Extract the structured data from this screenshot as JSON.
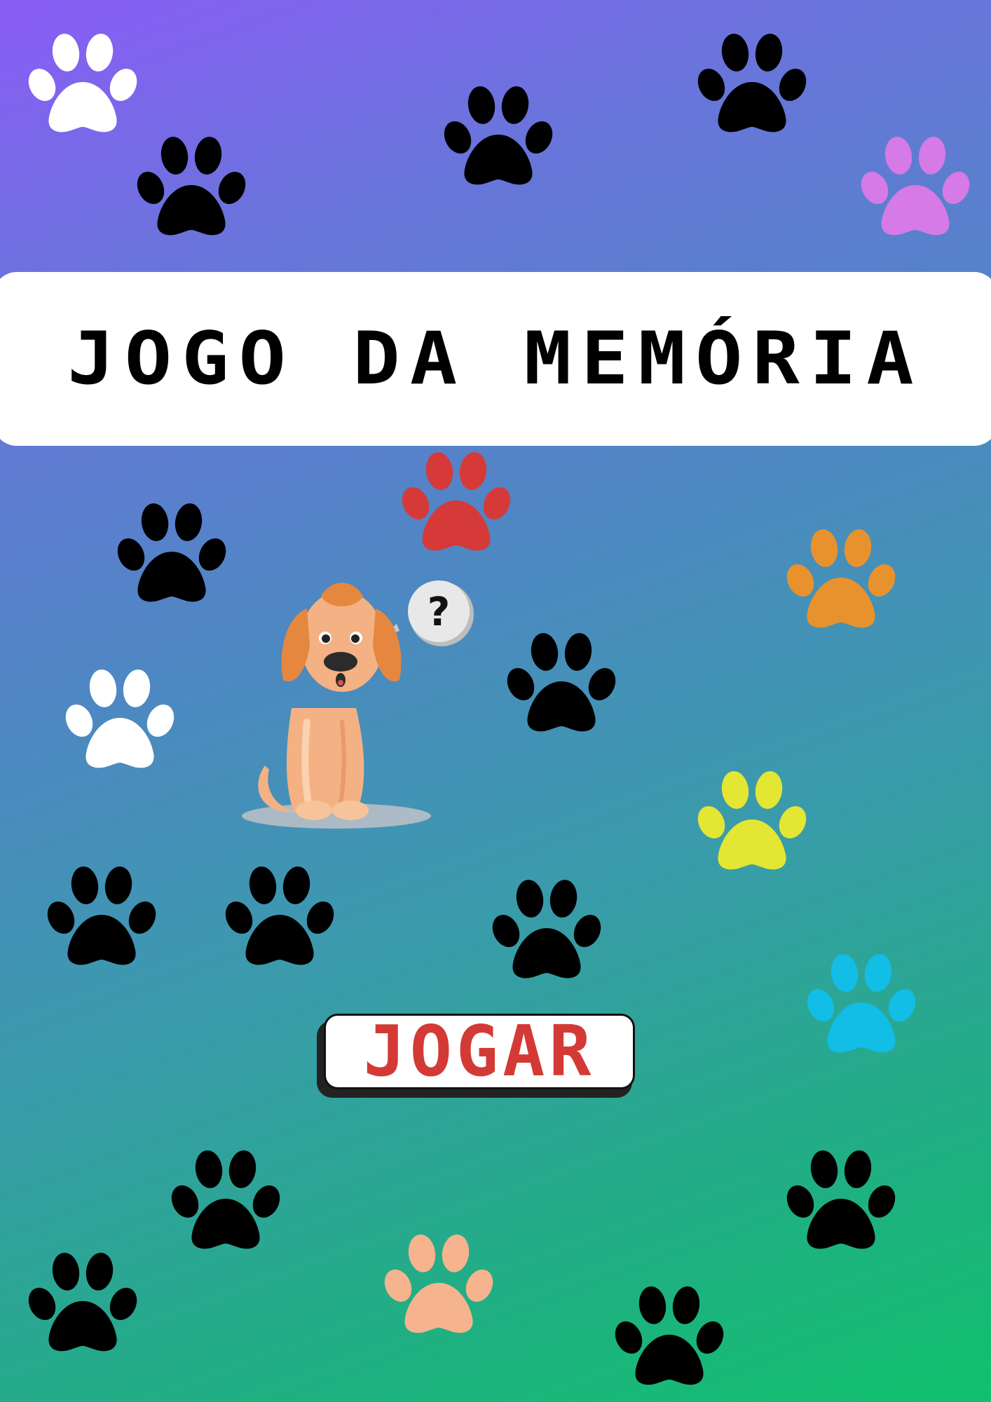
{
  "game": {
    "title": "JOGO DA MEMÓRIA",
    "play_button_label": "JOGAR"
  },
  "colors": {
    "background_top": "#8a5cf6",
    "background_bottom": "#10c06c",
    "banner": "#ffffff",
    "play_label": "#d33a36"
  },
  "icons": {
    "paw": "paw-print-icon",
    "mascot": "puppy-question-icon"
  },
  "paw_colors": [
    "#ffffff",
    "#000000",
    "#000000",
    "#000000",
    "#d57ae6",
    "#d63a38",
    "#000000",
    "#e8922e",
    "#ffffff",
    "#000000",
    "#e3e633",
    "#000000",
    "#000000",
    "#000000",
    "#12bde6",
    "#000000",
    "#000000",
    "#000000",
    "#f5b48e",
    "#000000"
  ]
}
